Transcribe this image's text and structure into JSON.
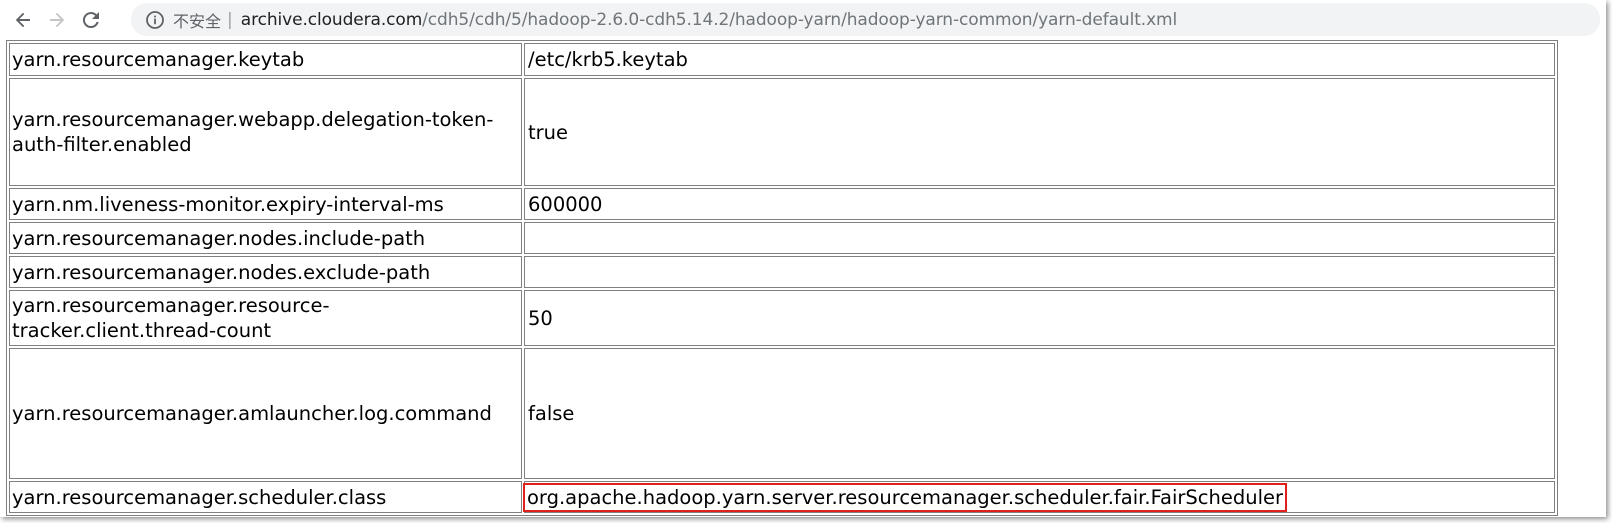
{
  "browser": {
    "insecure_label": "不安全",
    "separator": "|",
    "url_host": "archive.cloudera.com",
    "url_path": "/cdh5/cdh/5/hadoop-2.6.0-cdh5.14.2/hadoop-yarn/hadoop-yarn-common/yarn-default.xml",
    "icons": {
      "back": "arrow-left-icon",
      "forward": "arrow-right-icon",
      "reload": "reload-icon",
      "info": "info-circle-icon"
    }
  },
  "table": {
    "rows": [
      {
        "name": "yarn.resourcemanager.keytab",
        "value": "/etc/krb5.keytab"
      },
      {
        "name": "yarn.resourcemanager.webapp.delegation-token-auth-filter.enabled",
        "value": "true"
      },
      {
        "name": "yarn.nm.liveness-monitor.expiry-interval-ms",
        "value": "600000"
      },
      {
        "name": "yarn.resourcemanager.nodes.include-path",
        "value": ""
      },
      {
        "name": "yarn.resourcemanager.nodes.exclude-path",
        "value": ""
      },
      {
        "name": "yarn.resourcemanager.resource-tracker.client.thread-count",
        "value": "50"
      },
      {
        "name": "yarn.resourcemanager.amlauncher.log.command",
        "value": "false"
      },
      {
        "name": "yarn.resourcemanager.scheduler.class",
        "value": "org.apache.hadoop.yarn.server.resourcemanager.scheduler.fair.FairScheduler"
      }
    ]
  },
  "colors": {
    "highlight_border": "#e0201b",
    "cell_border": "#808080",
    "omnibox_bg": "#f1f3f4"
  }
}
